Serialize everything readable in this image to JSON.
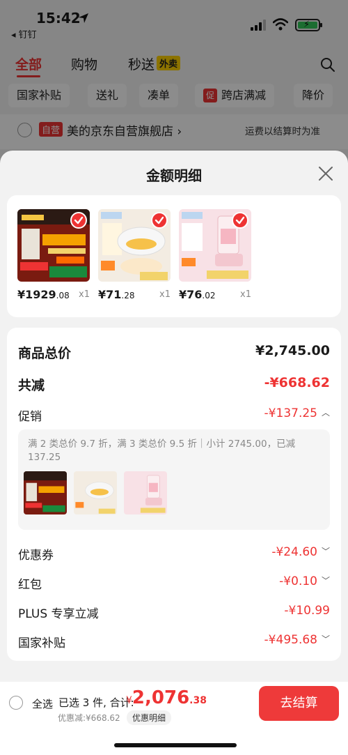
{
  "status": {
    "time": "15:42",
    "back_app": "◂ 钉钉"
  },
  "top_tabs": [
    {
      "label": "全部"
    },
    {
      "label": "购物"
    },
    {
      "label": "秒送"
    }
  ],
  "waimai_badge": "外卖",
  "filters": [
    "国家补贴",
    "送礼",
    "凑单",
    "跨店满减",
    "降价"
  ],
  "filter_promo_tag": "促",
  "store": {
    "tag": "自营",
    "name": "美的京东自营旗舰店 ›",
    "note": "运费以结算时为准"
  },
  "sheet": {
    "title": "金额明细"
  },
  "products": [
    {
      "price_int": "¥1929",
      "price_dec": ".08",
      "qty": "x1"
    },
    {
      "price_int": "¥71",
      "price_dec": ".28",
      "qty": "x1"
    },
    {
      "price_int": "¥76",
      "price_dec": ".02",
      "qty": "x1"
    }
  ],
  "detail": {
    "total_label": "商品总价",
    "total_value": "¥2,745.00",
    "reduce_label": "共减",
    "reduce_value": "-¥668.62",
    "promo_label": "促销",
    "promo_value": "-¥137.25",
    "promo_text": "满 2 类总价 9.7 折，满 3 类总价 9.5 折｜小计 2745.00，已减 137.25",
    "coupon_label": "优惠券",
    "coupon_value": "-¥24.60",
    "redpacket_label": "红包",
    "redpacket_value": "-¥0.10",
    "plus_label": "PLUS 专享立减",
    "plus_value": "-¥10.99",
    "subsidy_label": "国家补贴",
    "subsidy_value": "-¥495.68"
  },
  "bottom": {
    "select_all": "全选",
    "selected": "已选 3 件, 合计:",
    "total_sym": "¥",
    "total_int": "2,076",
    "total_dec": ".38",
    "discount": "优惠减:¥668.62",
    "detail_link": "优惠明细",
    "checkout": "去结算"
  },
  "colors": {
    "accent": "#ee3a3a",
    "green": "#34c759"
  },
  "icons": [
    "location-arrow-icon",
    "signal-icon",
    "wifi-icon",
    "battery-icon",
    "search-icon",
    "close-icon",
    "check-icon",
    "chevron-up-icon",
    "chevron-down-icon"
  ]
}
